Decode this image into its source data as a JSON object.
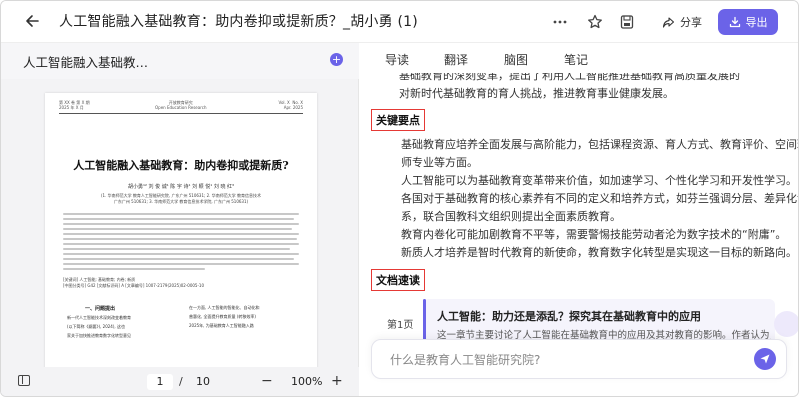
{
  "header": {
    "back_icon": "arrow-left-icon",
    "title": "人工智能融入基础教育：助内卷抑或提新质？_胡小勇 (1)",
    "more_icon": "more-icon",
    "star_icon": "star-icon",
    "save_icon": "save-icon",
    "share_label": "分享",
    "export_label": "导出",
    "accent_color": "#6b63e8"
  },
  "left": {
    "doc_title": "人工智能融入基础教…",
    "add_label": "+",
    "paper": {
      "header_left": "第 XX 卷 第 X 期\n2025 年 X 月",
      "header_center": "开放教育研究\nOpen Education Research",
      "header_right": "Vol. X  No. X\nApr. 2025",
      "title": "人工智能融入基础教育：助内卷抑或提新质?",
      "authors": "胡小勇¹²    刘 俊 诚¹    陈 宇 诗¹    刘 颖 悦¹    刘 晓 红³",
      "affil_1": "(1. 华南师范大学 教育人工智能研究院, 广东广州 510631; 2. 华南师范大学 教育信息技术",
      "affil_2": "广东广州 510631; 3. 华南师范大学 教育信息技术学院, 广东广州 510631)",
      "kw_1": "[关键词] 人工智能; 基础教育; 内卷; 新质",
      "kw_2": "[中图分类号] G42    [文献标识码] A    [文章编号] 1007-2179(2025)02-0005-10",
      "section_1": "一、问题提出",
      "col_left_1": "新一代人工智能技术深刻改变着教育",
      "col_left_2": "(以下简称《纲要》), 2024), 这也",
      "col_left_3": "家关于加快推进教育数字化转型意见",
      "col_right_1": "在一方面, 人工智能的智能化、自动化和",
      "col_right_2": "普惠化, 全面提升教育质量 (转移效率)",
      "col_right_3": "2025年, 为基础教育人工智能融入路"
    }
  },
  "pager": {
    "current_page": "1",
    "separator": "/",
    "total_pages": "10",
    "zoom_out": "−",
    "zoom": "100%",
    "zoom_in": "+"
  },
  "right": {
    "tabs": [
      "导读",
      "翻译",
      "脑图",
      "笔记"
    ],
    "intro_1": "基础教育的深刻变革，提出了利用人工智能推进基础教育高质量发展的",
    "intro_2": "对新时代基础教育的育人挑战，推进教育事业健康发展。",
    "key_points_label": "关键要点",
    "key_points": [
      "基础教育应培养全面发展与高阶能力，包括课程资源、育人方式、教育评价、空间环境和教",
      "师专业等方面。",
      "人工智能可以为基础教育变革带来价值，如加速学习、个性化学习和开发性学习。",
      "各国对于基础教育的核心素养有不同的定义和培养方式，如芬兰强调分层、差异化课程体",
      "系，联合国教科文组织则提出全面素质教育。",
      "教育内卷化可能加剧教育不平等，需要警惕技能劳动者沦为数字技术的“附庸”。",
      "新质人才培养是智时代教育的新使命，教育数字化转型是实现这一目标的新路向。"
    ],
    "speed_read_label": "文档速读",
    "page_label": "第1页",
    "card_title": "人工智能：助力还是添乱？探究其在基础教育中的应用",
    "card_text": "这一章节主要讨论了人工智能在基础教育中的应用及其对教育的影响。作者认为，人工智能的",
    "input_placeholder": "什么是教育人工智能研究院?",
    "send_icon": "send-icon"
  }
}
